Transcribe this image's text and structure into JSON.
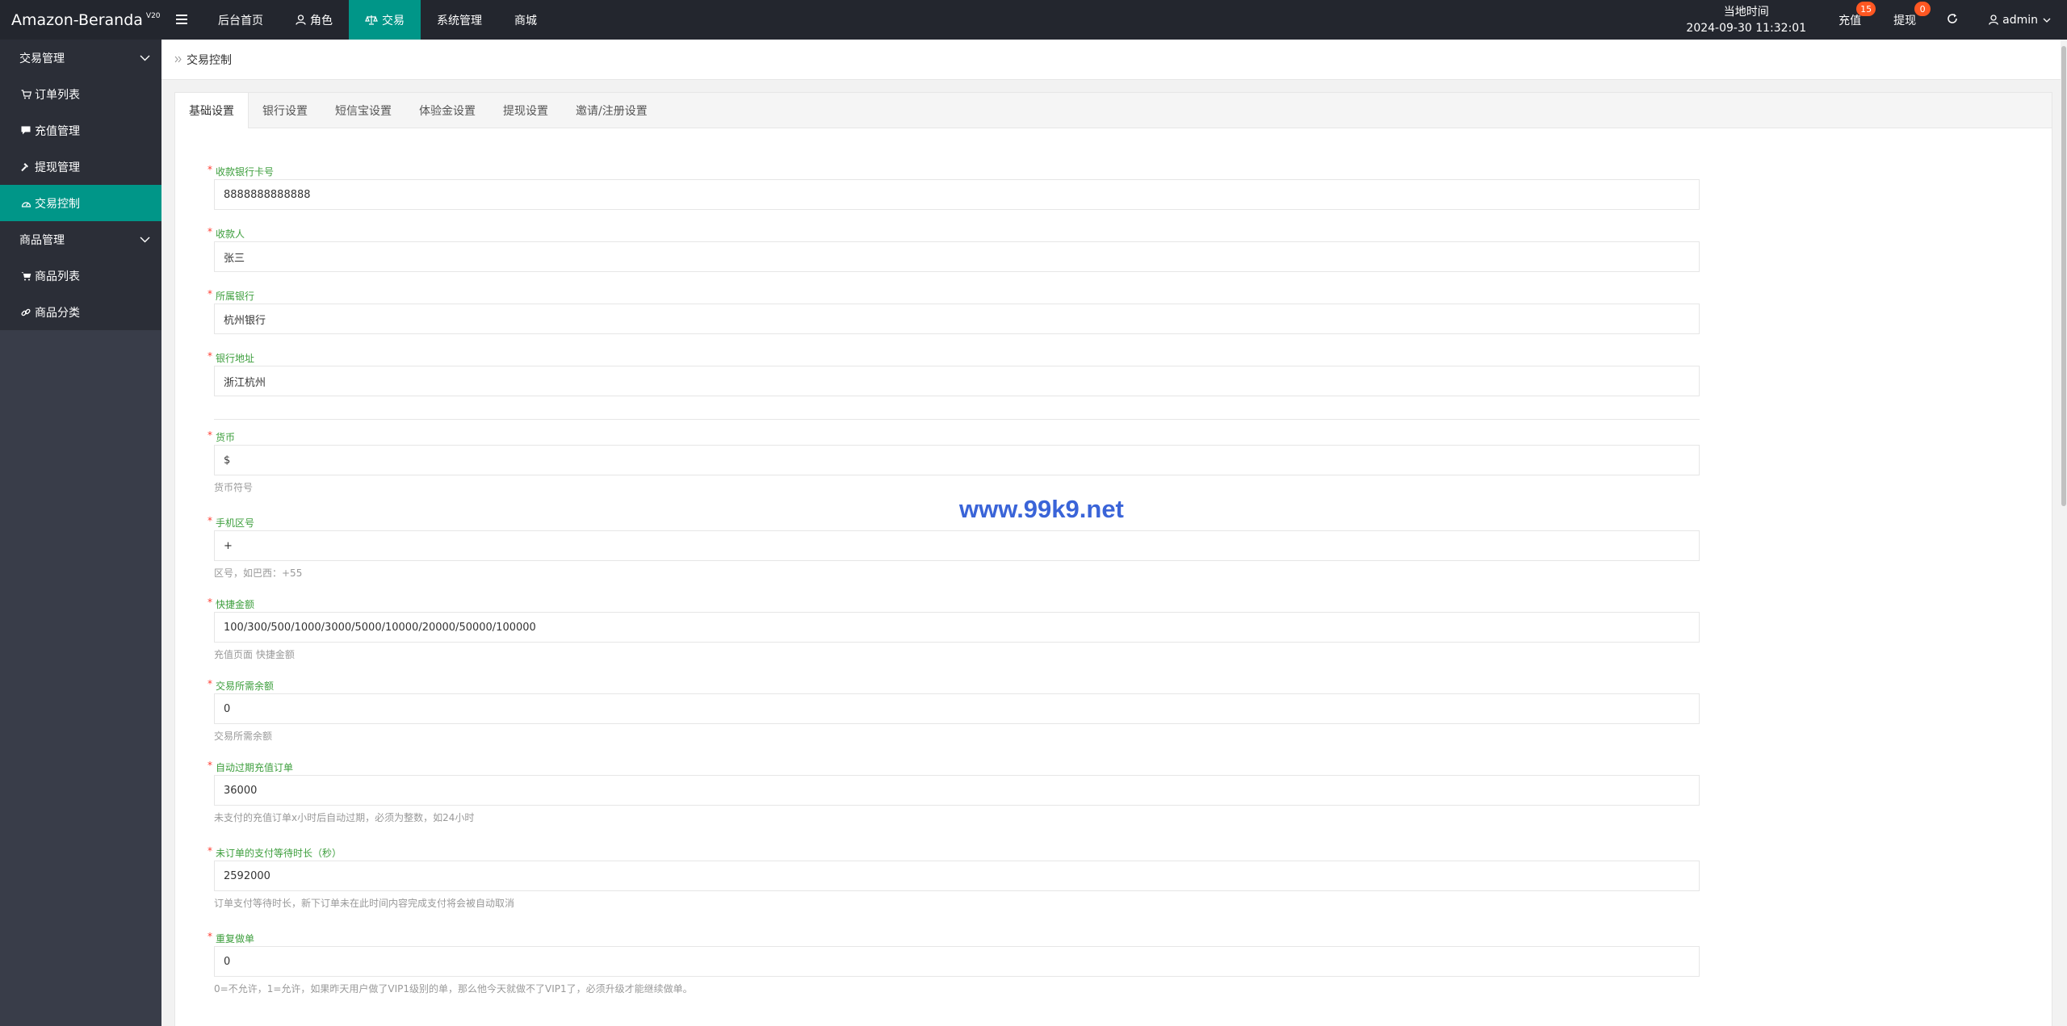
{
  "header": {
    "logo": "Amazon-Beranda",
    "logo_version": "V20",
    "nav": [
      {
        "label": "后台首页"
      },
      {
        "label": "角色"
      },
      {
        "label": "交易"
      },
      {
        "label": "系统管理"
      },
      {
        "label": "商城"
      }
    ],
    "time_label": "当地时间",
    "time_value": "2024-09-30 11:32:01",
    "recharge_label": "充值",
    "recharge_count": "15",
    "withdraw_label": "提现",
    "withdraw_count": "0",
    "user": "admin"
  },
  "sidebar": {
    "groups": [
      {
        "label": "交易管理",
        "items": [
          {
            "label": "订单列表",
            "icon": "cart-icon"
          },
          {
            "label": "充值管理",
            "icon": "comment-icon"
          },
          {
            "label": "提现管理",
            "icon": "hammer-icon"
          },
          {
            "label": "交易控制",
            "icon": "dashboard-icon"
          }
        ]
      },
      {
        "label": "商品管理",
        "items": [
          {
            "label": "商品列表",
            "icon": "cart-icon"
          },
          {
            "label": "商品分类",
            "icon": "link-icon"
          }
        ]
      }
    ]
  },
  "breadcrumb": "交易控制",
  "tabs": [
    "基础设置",
    "银行设置",
    "短信宝设置",
    "体验金设置",
    "提现设置",
    "邀请/注册设置"
  ],
  "form": {
    "fields": [
      {
        "label": "收款银行卡号",
        "value": "8888888888888",
        "hint": ""
      },
      {
        "label": "收款人",
        "value": "张三",
        "hint": ""
      },
      {
        "label": "所属银行",
        "value": "杭州银行",
        "hint": ""
      },
      {
        "label": "银行地址",
        "value": "浙江杭州",
        "hint": ""
      },
      {
        "label": "货币",
        "value": "$",
        "hint": "货币符号"
      },
      {
        "label": "手机区号",
        "value": "+",
        "hint": "区号，如巴西：+55"
      },
      {
        "label": "快捷金额",
        "value": "100/300/500/1000/3000/5000/10000/20000/50000/100000",
        "hint": "充值页面 快捷金额"
      },
      {
        "label": "交易所需余额",
        "value": "0",
        "hint": "交易所需余额"
      },
      {
        "label": "自动过期充值订单",
        "value": "36000",
        "hint": "未支付的充值订单x小时后自动过期，必须为整数，如24小时"
      },
      {
        "label": "未订单的支付等待时长（秒）",
        "value": "2592000",
        "hint": "订单支付等待时长，新下订单未在此时间内容完成支付将会被自动取消"
      },
      {
        "label": "重复做单",
        "value": "0",
        "hint": "0=不允许，1=允许，如果昨天用户做了VIP1级别的单，那么他今天就做不了VIP1了，必须升级才能继续做单。"
      }
    ]
  },
  "watermark": "www.99k9.net",
  "colors": {
    "accent": "#009688",
    "header_bg": "#23262e",
    "sidebar_bg": "#393d49",
    "badge": "#ff5722",
    "label_green": "#3c9e3c",
    "watermark": "#3a64d8"
  }
}
